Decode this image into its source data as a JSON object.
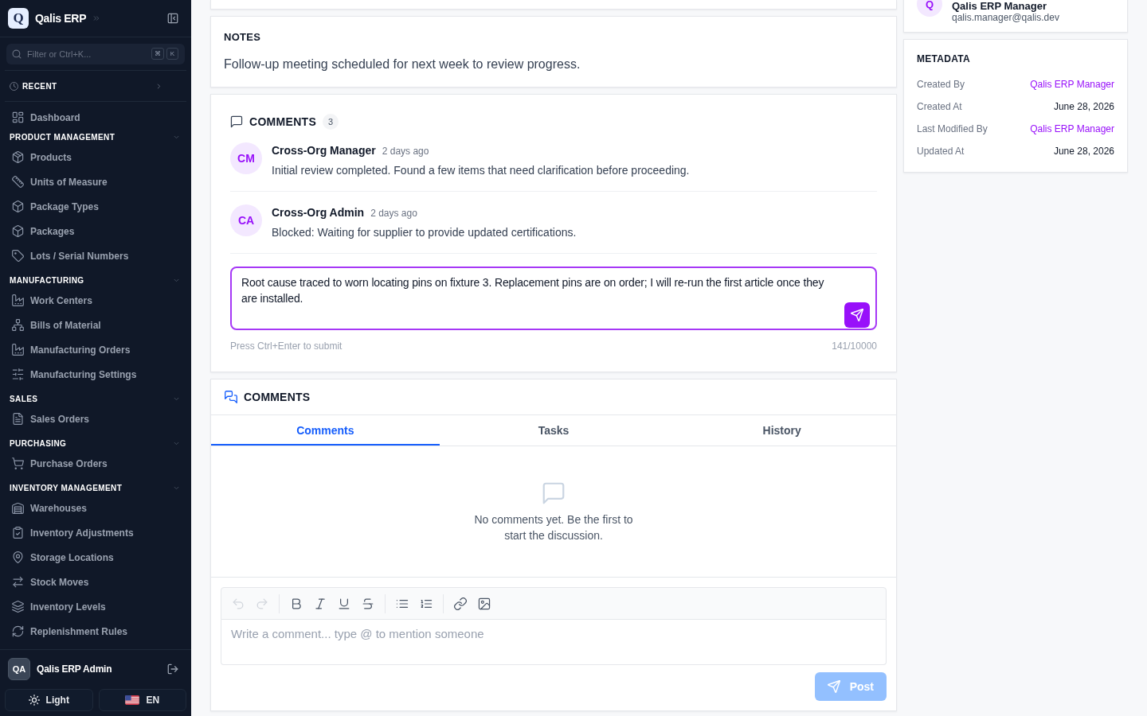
{
  "sidebar": {
    "brand": {
      "logo": "Q",
      "name": "Qalis ERP"
    },
    "search": {
      "placeholder": "Filter or Ctrl+K...",
      "keys": [
        "⌘",
        "K"
      ]
    },
    "recent": {
      "label": "RECENT",
      "expanded": false
    },
    "items": [
      {
        "label": "Dashboard",
        "selected": false
      }
    ],
    "sections": [
      {
        "title": "PRODUCT MANAGEMENT",
        "expanded": true,
        "items": [
          {
            "label": "Products",
            "selected": false
          },
          {
            "label": "Units of Measure",
            "selected": false
          },
          {
            "label": "Package Types",
            "selected": false
          },
          {
            "label": "Packages",
            "selected": false
          },
          {
            "label": "Lots / Serial Numbers",
            "selected": false
          }
        ]
      },
      {
        "title": "MANUFACTURING",
        "expanded": true,
        "items": [
          {
            "label": "Work Centers",
            "selected": false
          },
          {
            "label": "Bills of Material",
            "selected": false
          },
          {
            "label": "Manufacturing Orders",
            "selected": false
          },
          {
            "label": "Manufacturing Settings",
            "selected": false
          }
        ]
      },
      {
        "title": "SALES",
        "expanded": true,
        "items": [
          {
            "label": "Sales Orders",
            "selected": false
          }
        ]
      },
      {
        "title": "PURCHASING",
        "expanded": true,
        "items": [
          {
            "label": "Purchase Orders",
            "selected": false
          }
        ]
      },
      {
        "title": "INVENTORY MANAGEMENT",
        "expanded": true,
        "items": [
          {
            "label": "Warehouses",
            "selected": false
          },
          {
            "label": "Inventory Adjustments",
            "selected": false
          },
          {
            "label": "Storage Locations",
            "selected": false
          },
          {
            "label": "Stock Moves",
            "selected": false
          },
          {
            "label": "Inventory Levels",
            "selected": false
          },
          {
            "label": "Replenishment Rules",
            "selected": false
          }
        ]
      }
    ],
    "user": {
      "initials": "QA",
      "name": "Qalis ERP Admin"
    },
    "theme_button": {
      "label": "Light"
    },
    "language_button": {
      "label": "EN"
    }
  },
  "notes": {
    "title": "NOTES",
    "text": "Follow-up meeting scheduled for next week to review progress."
  },
  "comments": {
    "title": "COMMENTS",
    "count": "3",
    "items": [
      {
        "initials": "CM",
        "author": "Cross-Org Manager",
        "time": "2 days ago",
        "text": "Initial review completed. Found a few items that need clarification before proceeding."
      },
      {
        "initials": "CA",
        "author": "Cross-Org Admin",
        "time": "2 days ago",
        "text": "Blocked: Waiting for supplier to provide updated certifications."
      }
    ],
    "draft": {
      "value": "Root cause traced to worn locating pins on fixture 3. Replacement pins are on order; I will re-run the first article once they are installed.",
      "hint": "Press Ctrl+Enter to submit",
      "counter": "141/10000"
    }
  },
  "discussion": {
    "title": "COMMENTS",
    "tabs": [
      {
        "label": "Comments",
        "selected": true
      },
      {
        "label": "Tasks",
        "selected": false
      },
      {
        "label": "History",
        "selected": false
      }
    ],
    "empty_text": "No comments yet. Be the first to start the discussion.",
    "toolbar": [
      [
        {
          "kind": "undo",
          "disabled": true
        },
        {
          "kind": "redo",
          "disabled": true
        }
      ],
      [
        {
          "kind": "bold",
          "disabled": false
        },
        {
          "kind": "italic",
          "disabled": false
        },
        {
          "kind": "underline",
          "disabled": false
        },
        {
          "kind": "strikethrough",
          "disabled": false
        }
      ],
      [
        {
          "kind": "bullet_list",
          "disabled": false
        },
        {
          "kind": "numbered_list",
          "disabled": false
        }
      ],
      [
        {
          "kind": "link",
          "disabled": false
        },
        {
          "kind": "image",
          "disabled": false
        }
      ]
    ],
    "editor": {
      "placeholder": "Write a comment... type @ to mention someone"
    },
    "post_button": {
      "label": "Post",
      "disabled": true
    }
  },
  "profile": {
    "initials": "Q",
    "name": "Qalis ERP Manager",
    "email": "qalis.manager@qalis.dev"
  },
  "metadata": {
    "title": "METADATA",
    "rows": [
      {
        "label": "Created By",
        "value": "Qalis ERP Manager",
        "kind": "link"
      },
      {
        "label": "Created At",
        "value": "June 28, 2026",
        "kind": "text"
      },
      {
        "label": "Last Modified By",
        "value": "Qalis ERP Manager",
        "kind": "link"
      },
      {
        "label": "Updated At",
        "value": "June 28, 2026",
        "kind": "text"
      }
    ]
  }
}
